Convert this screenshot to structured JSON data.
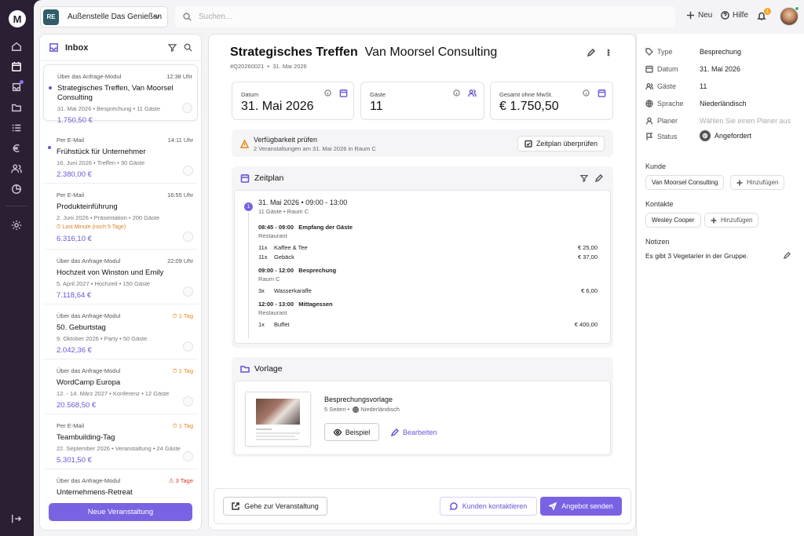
{
  "nav": {
    "logo": "M"
  },
  "topbar": {
    "location_badge": "RE",
    "location_name": "Außenstelle Das Genießen",
    "search_placeholder": "Suchen...",
    "new_label": "Neu",
    "help_label": "Hilfe",
    "notif_count": "1"
  },
  "inbox": {
    "title": "Inbox",
    "new_event_label": "Neue Veranstaltung",
    "items": [
      {
        "source": "Über das Anfrage-Modul",
        "time": "12:38 Uhr",
        "title": "Strategisches Treffen, Van Moorsel Consulting",
        "meta": "31. Mai 2026 • Besprechung • 11 Gäste",
        "price": "1.750,50 €",
        "flag": ""
      },
      {
        "source": "Per E-Mail",
        "time": "14:11 Uhr",
        "title": "Frühstück für Unternehmer",
        "meta": "16. Juni 2026 • Treffen • 30 Gäste",
        "price": "2.380,00 €",
        "flag": ""
      },
      {
        "source": "Per E-Mail",
        "time": "16:55 Uhr",
        "title": "Produkteinführung",
        "meta": "2. Juni 2026 • Präsentation • 200 Gäste",
        "price": "6.316,10 €",
        "flag": "Last Minute (noch 5 Tage)"
      },
      {
        "source": "Über das Anfrage-Modul",
        "time": "22:09 Uhr",
        "title": "Hochzeit von Winston und Emily",
        "meta": "5. April 2027 • Hochzeit • 150 Gäste",
        "price": "7.118,64 €",
        "flag": ""
      },
      {
        "source": "Über das Anfrage-Modul",
        "time": "1 Tag",
        "title": "50. Geburtstag",
        "meta": "9. Oktober 2026 • Party • 50 Gäste",
        "price": "2.042,36 €",
        "flag": ""
      },
      {
        "source": "Über das Anfrage-Modul",
        "time": "1 Tag",
        "title": "WordCamp Europa",
        "meta": "12. - 14. März 2027 • Konferenz • 12 Gäste",
        "price": "20.568,50 €",
        "flag": ""
      },
      {
        "source": "Per E-Mail",
        "time": "1 Tag",
        "title": "Teambuilding-Tag",
        "meta": "22. September 2026 • Veranstaltung • 24 Gäste",
        "price": "5.301,50 €",
        "flag": ""
      },
      {
        "source": "Über das Anfrage-Modul",
        "time": "3 Tage",
        "title": "Unternehmens-Retreat",
        "meta": "",
        "price": "",
        "flag": ""
      }
    ]
  },
  "event": {
    "title_bold": "Strategisches Treffen",
    "title_rest": "Van Moorsel Consulting",
    "code": "#Q20260021",
    "date_short": "31. Mai 2026",
    "stats": [
      {
        "label": "Datum",
        "value": "31. Mai 2026"
      },
      {
        "label": "Gäste",
        "value": "11"
      },
      {
        "label": "Gesamt ohne MwSt.",
        "value": "€ 1.750,50"
      }
    ],
    "availability": {
      "title": "Verfügbarkeit prüfen",
      "subtitle": "2 Veranstaltungen am 31. Mai 2026 in Raum C",
      "button": "Zeitplan überprüfen"
    },
    "schedule": {
      "title": "Zeitplan",
      "step": "1",
      "day": "31. Mai 2026 • 09:00 - 13:00",
      "day_sub": "11 Gäste • Raum C",
      "blocks": [
        {
          "time": "08:45 - 09:00",
          "name": "Empfang der Gäste",
          "place": "Restaurant",
          "items": [
            {
              "qty": "11x",
              "name": "Kaffee & Tee",
              "price": "€ 25,00"
            },
            {
              "qty": "11x",
              "name": "Gebäck",
              "price": "€ 37,00"
            }
          ]
        },
        {
          "time": "09:00 - 12:00",
          "name": "Besprechung",
          "place": "Raum C",
          "items": [
            {
              "qty": "3x",
              "name": "Wasserkaraffe",
              "price": "€ 6,00"
            }
          ]
        },
        {
          "time": "12:00 - 13:00",
          "name": "Mittagessen",
          "place": "Restaurant",
          "items": [
            {
              "qty": "1x",
              "name": "Buffet",
              "price": "€ 400,00"
            }
          ]
        }
      ]
    },
    "template": {
      "title": "Vorlage",
      "name": "Besprechungsvorlage",
      "pages": "5 Seiten",
      "language": "Niederländisch",
      "example_btn": "Beispiel",
      "edit_btn": "Bearbeiten"
    },
    "footer": {
      "goto": "Gehe zur Veranstaltung",
      "contact": "Kunden kontaktieren",
      "send": "Angebot senden"
    }
  },
  "details": {
    "props": [
      {
        "label": "Type",
        "value": "Besprechung"
      },
      {
        "label": "Datum",
        "value": "31. Mai 2026"
      },
      {
        "label": "Gäste",
        "value": "11"
      },
      {
        "label": "Sprache",
        "value": "Niederländisch"
      },
      {
        "label": "Planer",
        "value": "Wählen Sie einen Planer aus"
      },
      {
        "label": "Status",
        "value": "Angefordert"
      }
    ],
    "client_label": "Kunde",
    "client": "Van Moorsel Consulting",
    "add_label": "Hinzufügen",
    "contacts_label": "Kontakte",
    "contact": "Wesley Cooper",
    "notes_label": "Notizen",
    "note": "Es gibt 3 Vegetarier in der Gruppe."
  },
  "colors": {
    "accent": "#7b62e3",
    "rail": "#2b1f33",
    "warning": "#e08a16",
    "alert": "#d0392b"
  }
}
